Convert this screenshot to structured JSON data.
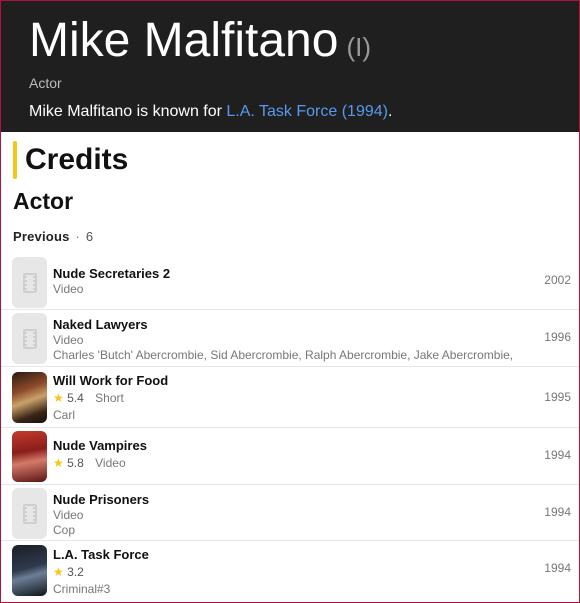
{
  "person": {
    "name": "Mike Malfitano",
    "qualifier": "(I)",
    "role": "Actor",
    "known_prefix": "Mike Malfitano is known for ",
    "known_link": "L.A. Task Force (1994)",
    "known_suffix": "."
  },
  "credits": {
    "title": "Credits",
    "section": "Actor",
    "tab_label": "Previous",
    "tab_separator": "·",
    "tab_count": "6",
    "items": [
      {
        "title": "Nude Secretaries 2",
        "type": "Video",
        "rating": "",
        "detail": "",
        "year": "2002"
      },
      {
        "title": "Naked Lawyers",
        "type": "Video",
        "rating": "",
        "detail": "Charles 'Butch' Abercrombie, Sid Abercrombie, Ralph Abercrombie, Jake Abercrombie,",
        "year": "1996"
      },
      {
        "title": "Will Work for Food",
        "type": "Short",
        "rating": "5.4",
        "detail": "Carl",
        "year": "1995"
      },
      {
        "title": "Nude Vampires",
        "type": "Video",
        "rating": "5.8",
        "detail": "",
        "year": "1994"
      },
      {
        "title": "Nude Prisoners",
        "type": "Video",
        "rating": "",
        "detail": "Cop",
        "year": "1994"
      },
      {
        "title": "L.A. Task Force",
        "type": "",
        "rating": "3.2",
        "detail": "Criminal#3",
        "year": "1994"
      }
    ]
  },
  "icons": {
    "star": "star-icon",
    "placeholder": "film-placeholder-icon"
  },
  "colors": {
    "header_bg": "#1f1f1f",
    "link": "#5799ef",
    "accent": "#f5c518"
  }
}
